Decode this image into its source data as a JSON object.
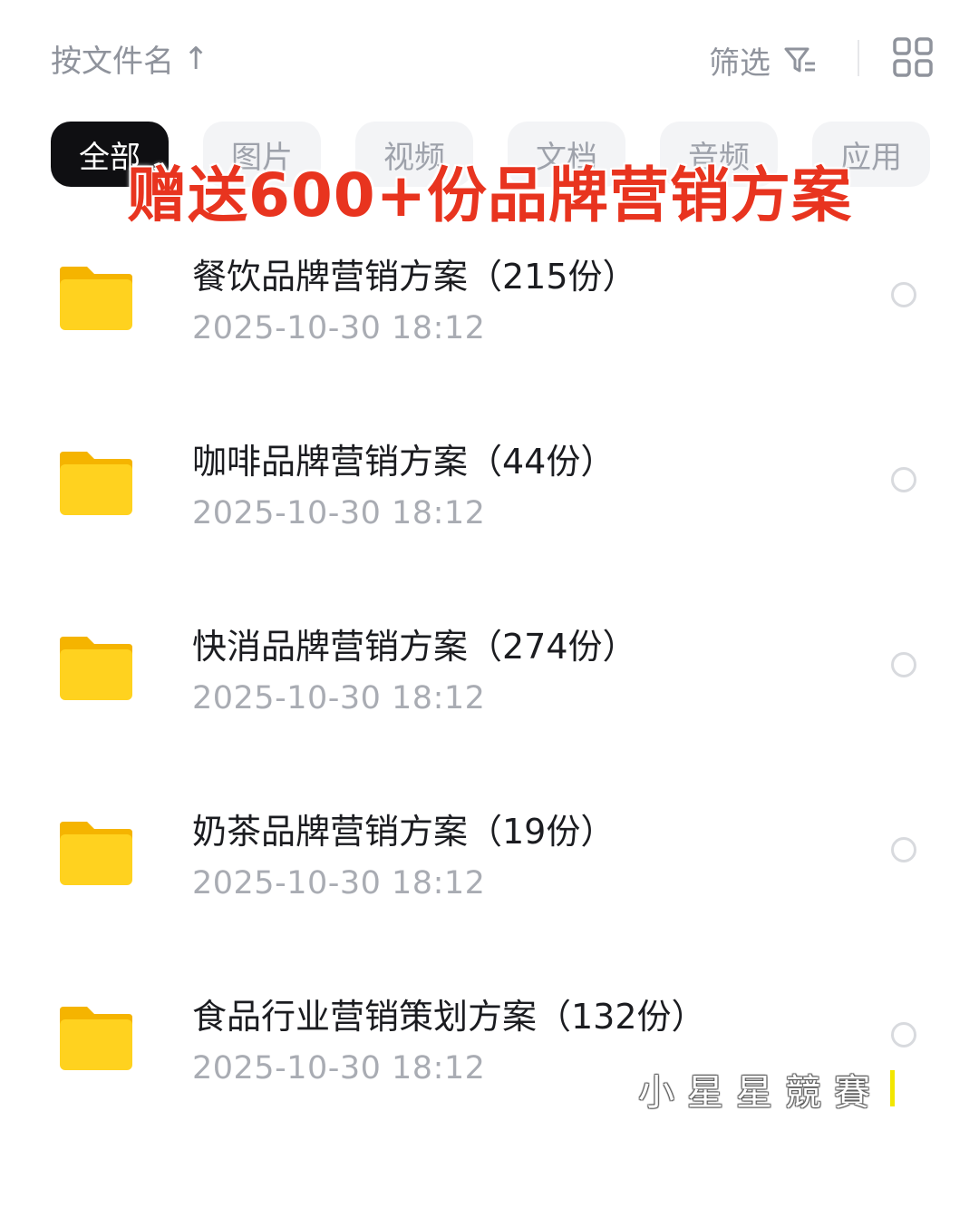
{
  "toolbar": {
    "sort_label": "按文件名",
    "sort_arrow": "↑",
    "filter_label": "筛选"
  },
  "tabs": [
    {
      "label": "全部",
      "active": true
    },
    {
      "label": "图片",
      "active": false
    },
    {
      "label": "视频",
      "active": false
    },
    {
      "label": "文档",
      "active": false
    },
    {
      "label": "音频",
      "active": false
    },
    {
      "label": "应用",
      "active": false
    }
  ],
  "banner": "赠送600+份品牌营销方案",
  "files": [
    {
      "name": "餐饮品牌营销方案（215份）",
      "date": "2025-10-30  18:12"
    },
    {
      "name": "咖啡品牌营销方案（44份）",
      "date": "2025-10-30  18:12"
    },
    {
      "name": "快消品牌营销方案（274份）",
      "date": "2025-10-30  18:12"
    },
    {
      "name": "奶茶品牌营销方案（19份）",
      "date": "2025-10-30  18:12"
    },
    {
      "name": "食品行业营销策划方案（132份）",
      "date": "2025-10-30  18:12"
    }
  ],
  "watermark": "小星星競賽",
  "colors": {
    "banner": "#e8341f",
    "folder": "#ffd21f",
    "active_tab": "#0f0f12"
  }
}
